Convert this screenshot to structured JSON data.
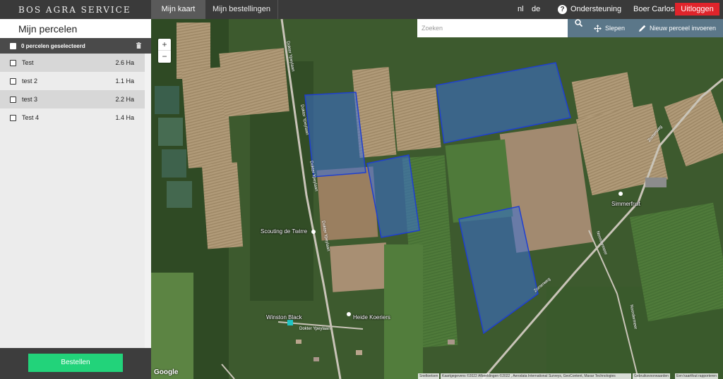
{
  "header": {
    "brand": "Bos Agra Service",
    "tabs": [
      {
        "label": "Mijn kaart",
        "active": true
      },
      {
        "label": "Mijn bestellingen",
        "active": false
      }
    ],
    "languages": [
      "nl",
      "de"
    ],
    "support_label": "Ondersteuning",
    "user_name": "Boer Carlos",
    "logout_label": "Uitloggen"
  },
  "sidebar": {
    "title": "Mijn percelen",
    "selected_label": "0 percelen geselecteerd",
    "parcels": [
      {
        "name": "Test",
        "area": "2.6 Ha"
      },
      {
        "name": "test 2",
        "area": "1.1 Ha"
      },
      {
        "name": "test 3",
        "area": "2.2 Ha"
      },
      {
        "name": "Test 4",
        "area": "1.4 Ha"
      }
    ],
    "order_label": "Bestellen"
  },
  "map": {
    "search_placeholder": "Zoeken",
    "tools": {
      "drag_label": "Slepen",
      "new_parcel_label": "Nieuw perceel invoeren"
    },
    "zoom": {
      "in": "+",
      "out": "−"
    },
    "places": {
      "scouting": "Scouting de Twirre",
      "winston": "Winston Black",
      "heide": "Heide Koeriers",
      "simmer": "Simmerfruit"
    },
    "roads": {
      "dokter1": "Dokter Ypeylaan",
      "dokter2": "Dokter Ypeylaan",
      "dokter3": "Dokter Ypeylaan",
      "dokter4": "Dokter Ypeylaan",
      "dokter_bottom": "Dokter Ypeylaan",
      "zomerweg1": "Zomerweg",
      "zomerweg2": "Zomerweg",
      "noordermeer": "Noordermeer",
      "noordermeer2": "Noordermeer"
    },
    "google_label": "Google",
    "attribution": {
      "shortcuts": "Sneltoetsen",
      "data": "Kaartgegevens ©2022 Afbeeldingen ©2022 , Aerodata International Surveys, GeoContent, Maxar Technologies",
      "terms": "Gebruiksvoorwaarden",
      "report": "Een kaartfout rapporteren"
    },
    "colors": {
      "parcel_fill": "#3b6fd6",
      "parcel_stroke": "#1f3fd0"
    }
  }
}
